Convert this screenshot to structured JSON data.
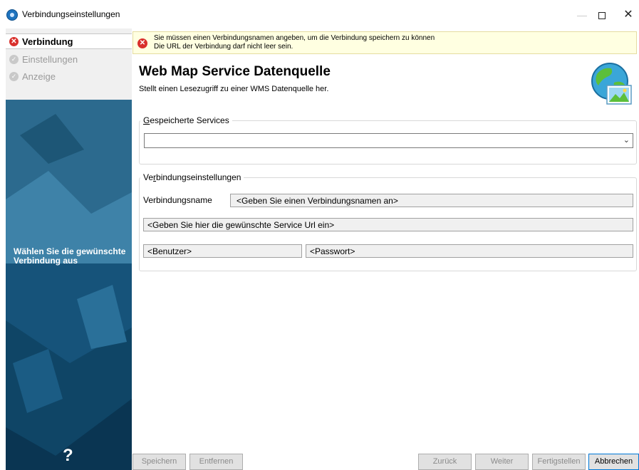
{
  "window": {
    "title": "Verbindungseinstellungen",
    "minimize_glyph": "—",
    "close_glyph": "✕"
  },
  "steps": [
    {
      "label": "Verbindung",
      "status": "error"
    },
    {
      "label": "Einstellungen",
      "status": "pending"
    },
    {
      "label": "Anzeige",
      "status": "pending"
    }
  ],
  "left_panel": {
    "hint": "Wählen Sie die gewünschte Verbindung aus",
    "help_glyph": "?"
  },
  "errors": [
    "Sie müssen einen Verbindungsnamen angeben, um die Verbindung speichern zu können",
    "Die URL der Verbindung darf nicht leer sein."
  ],
  "header": {
    "title": "Web Map Service Datenquelle",
    "subtitle": "Stellt einen Lesezugriff zu einer WMS Datenquelle her."
  },
  "saved_services": {
    "legend_prefix": "G",
    "legend_rest": "espeicherte Services",
    "selected_value": ""
  },
  "connection": {
    "legend_prefix": "Ve",
    "legend_accel": "r",
    "legend_rest": "bindungseinstellungen",
    "name_label": "Verbindungsname",
    "name_value": "<Geben Sie einen Verbindungsnamen an>",
    "url_value": "<Geben Sie hier die gewünschte Service Url ein>",
    "user_value": "<Benutzer>",
    "password_value": "<Passwort>"
  },
  "buttons": {
    "save": "Speichern",
    "remove": "Entfernen",
    "back": "Zurück",
    "next": "Weiter",
    "finish": "Fertigstellen",
    "cancel": "Abbrechen"
  },
  "colors": {
    "error": "#d9302c",
    "banner": "#ffffe1",
    "panel": "#1a5a82",
    "accent": "#0078d7"
  }
}
